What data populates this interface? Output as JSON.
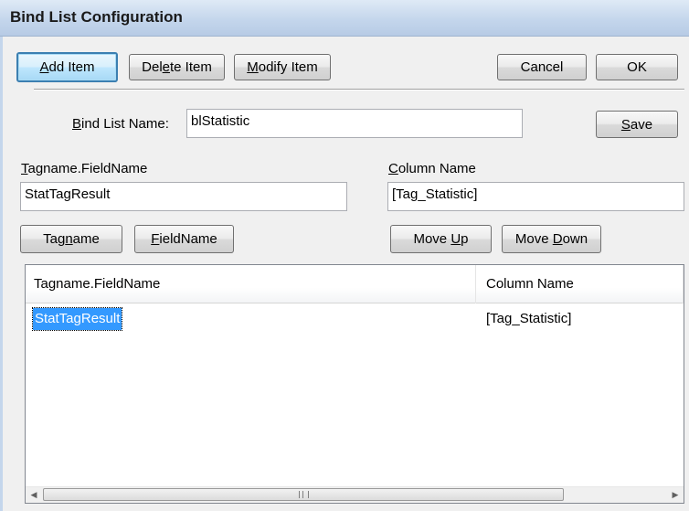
{
  "window": {
    "title": "Bind List Configuration"
  },
  "toolbar": {
    "add_item": {
      "pre": "",
      "key": "A",
      "post": "dd Item"
    },
    "delete_item": {
      "pre": "Del",
      "key": "e",
      "post": "te Item"
    },
    "modify_item": {
      "pre": "",
      "key": "M",
      "post": "odify Item"
    },
    "cancel": "Cancel",
    "ok": "OK"
  },
  "bind_list": {
    "label": {
      "pre": "",
      "key": "B",
      "post": "ind List Name:"
    },
    "value": "blStatistic",
    "save": {
      "pre": "",
      "key": "S",
      "post": "ave"
    }
  },
  "tagname_field": {
    "label": {
      "pre": "",
      "key": "T",
      "post": "agname.FieldName"
    },
    "value": "StatTagResult"
  },
  "column_field": {
    "label": {
      "pre": "",
      "key": "C",
      "post": "olumn Name"
    },
    "value": "[Tag_Statistic]"
  },
  "buttons": {
    "tagname": {
      "pre": "Tag",
      "key": "n",
      "post": "ame"
    },
    "fieldname": {
      "pre": "",
      "key": "F",
      "post": "ieldName"
    },
    "move_up": {
      "pre": "Move ",
      "key": "U",
      "post": "p"
    },
    "move_down": {
      "pre": "Move ",
      "key": "D",
      "post": "own"
    }
  },
  "list": {
    "columns": [
      "Tagname.FieldName",
      "Column Name"
    ],
    "rows": [
      {
        "tagname": "StatTagResult",
        "column": "[Tag_Statistic]"
      }
    ]
  },
  "colors": {
    "selection": "#3399ff",
    "title_bar": "#c4d6ec"
  }
}
